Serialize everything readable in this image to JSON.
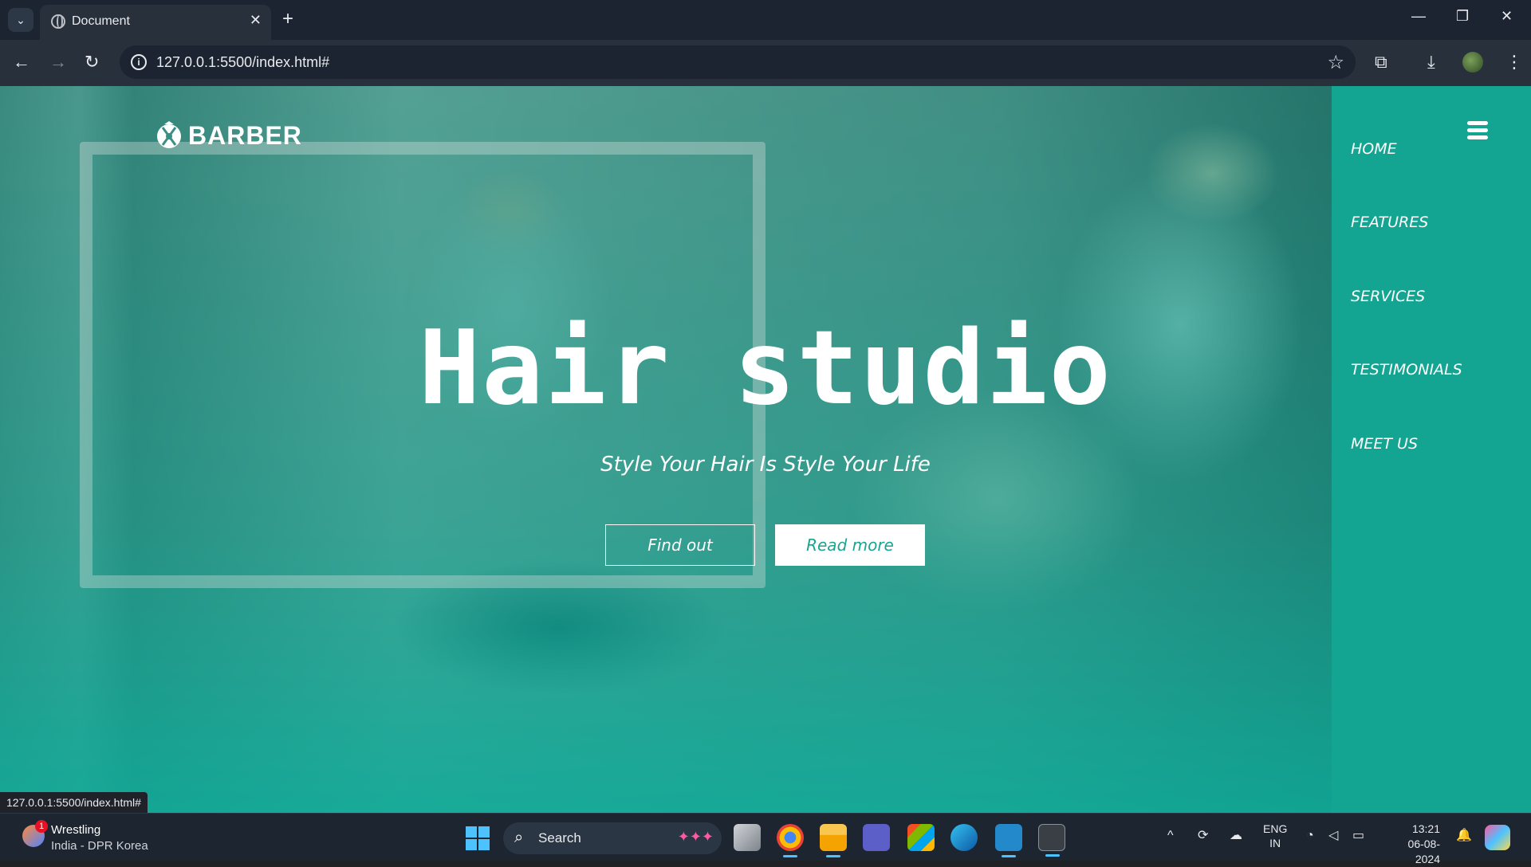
{
  "browser": {
    "tab_title": "Document",
    "url": "127.0.0.1:5500/index.html#",
    "status_url": "127.0.0.1:5500/index.html#"
  },
  "site": {
    "logo_text": "BARBER",
    "hero_title": "Hair studio",
    "hero_subtitle": "Style Your Hair Is Style Your Life",
    "btn_find": "Find out",
    "btn_read": "Read more",
    "nav": [
      "HOME",
      "FEATURES",
      "SERVICES",
      "TESTIMONIALS",
      "MEET US"
    ],
    "colors": {
      "accent": "#14a592",
      "text": "#ffffff"
    }
  },
  "taskbar": {
    "weather_title": "Wrestling",
    "weather_sub": "India - DPR Korea",
    "weather_badge": "1",
    "search_label": "Search",
    "lang_1": "ENG",
    "lang_2": "IN",
    "time": "13:21",
    "date": "06-08-2024"
  }
}
